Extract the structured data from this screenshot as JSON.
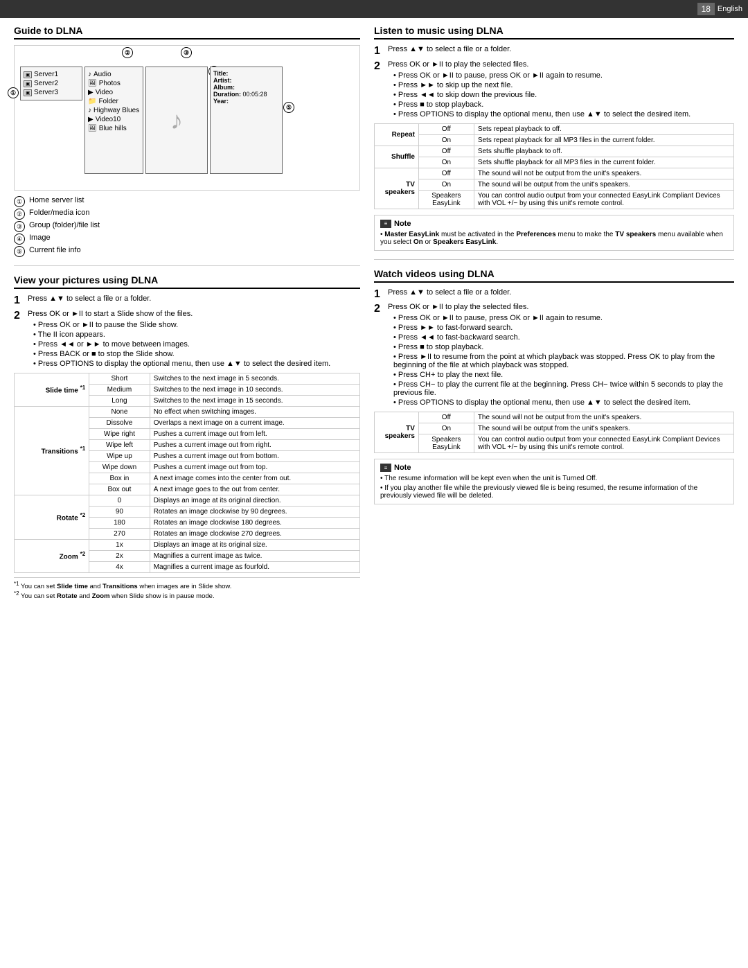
{
  "topbar": {
    "page": "18",
    "language": "English"
  },
  "left": {
    "guide_section": {
      "title": "Guide to DLNA",
      "diagram": {
        "callouts": [
          "①",
          "②",
          "③",
          "④",
          "⑤"
        ],
        "servers": [
          "Server1",
          "Server2",
          "Server3"
        ],
        "folders": [
          "Audio",
          "Photos",
          "Video",
          "Folder",
          "Highway Blues",
          "Video10",
          "Blue hills"
        ],
        "fileinfo": {
          "title_label": "Title:",
          "artist_label": "Artist:",
          "album_label": "Album:",
          "duration_label": "Duration:",
          "duration_value": "00:05:28",
          "year_label": "Year:"
        }
      },
      "legend": [
        {
          "num": "①",
          "text": "Home server list"
        },
        {
          "num": "②",
          "text": "Folder/media icon"
        },
        {
          "num": "③",
          "text": "Group (folder)/file list"
        },
        {
          "num": "④",
          "text": "Image"
        },
        {
          "num": "⑤",
          "text": "Current file info"
        }
      ]
    },
    "view_section": {
      "title": "View your pictures using DLNA",
      "step1": "Press ▲▼ to select a file or a folder.",
      "step2": "Press OK or ►II to start a Slide show of the files.",
      "bullets": [
        "Press OK or ►II to pause the Slide show.",
        "The II icon appears.",
        "Press ◄◄ or ►► to move between images.",
        "Press BACK or ■ to stop the Slide show.",
        "Press OPTIONS to display the optional menu, then use ▲▼ to select the desired item."
      ],
      "table": {
        "rows": [
          {
            "group": "Slide time *1",
            "entries": [
              {
                "sub": "Short",
                "desc": "Switches to the next image in 5 seconds."
              },
              {
                "sub": "Medium",
                "desc": "Switches to the next image in 10 seconds."
              },
              {
                "sub": "Long",
                "desc": "Switches to the next image in 15 seconds."
              }
            ]
          },
          {
            "group": "Transitions *1",
            "entries": [
              {
                "sub": "None",
                "desc": "No effect when switching images."
              },
              {
                "sub": "Dissolve",
                "desc": "Overlaps a next image on a current image."
              },
              {
                "sub": "Wipe right",
                "desc": "Pushes a current image out from left."
              },
              {
                "sub": "Wipe left",
                "desc": "Pushes a current image out from right."
              },
              {
                "sub": "Wipe up",
                "desc": "Pushes a current image out from bottom."
              },
              {
                "sub": "Wipe down",
                "desc": "Pushes a current image out from top."
              },
              {
                "sub": "Box in",
                "desc": "A next image comes into the center from out."
              },
              {
                "sub": "Box out",
                "desc": "A next image goes to the out from center."
              }
            ]
          },
          {
            "group": "Rotate *2",
            "entries": [
              {
                "sub": "0",
                "desc": "Displays an image at its original direction."
              },
              {
                "sub": "90",
                "desc": "Rotates an image clockwise by 90 degrees."
              },
              {
                "sub": "180",
                "desc": "Rotates an image clockwise 180 degrees."
              },
              {
                "sub": "270",
                "desc": "Rotates an image clockwise 270 degrees."
              }
            ]
          },
          {
            "group": "Zoom *2",
            "entries": [
              {
                "sub": "1x",
                "desc": "Displays an image at its original size."
              },
              {
                "sub": "2x",
                "desc": "Magnifies a current image as twice."
              },
              {
                "sub": "4x",
                "desc": "Magnifies a current image as fourfold."
              }
            ]
          }
        ]
      },
      "footnotes": [
        "*1 You can set Slide time and Transitions when images are in Slide show.",
        "*2 You can set Rotate and Zoom when Slide show is in pause mode."
      ]
    }
  },
  "right": {
    "listen_section": {
      "title": "Listen to music using DLNA",
      "step1": "Press ▲▼ to select a file or a folder.",
      "step2": "Press OK or ►II to play the selected files.",
      "bullets": [
        "Press OK or ►II to pause, press OK or ►II again to resume.",
        "Press ►► to skip up the next file.",
        "Press ◄◄ to skip down the previous file.",
        "Press ■ to stop playback.",
        "Press OPTIONS to display the optional menu, then use ▲▼ to select the desired item."
      ],
      "table": {
        "rows": [
          {
            "group": "Repeat",
            "entries": [
              {
                "sub": "Off",
                "desc": "Sets repeat playback to off."
              },
              {
                "sub": "On",
                "desc": "Sets repeat playback for all MP3 files in the current folder."
              }
            ]
          },
          {
            "group": "Shuffle",
            "entries": [
              {
                "sub": "Off",
                "desc": "Sets shuffle playback to off."
              },
              {
                "sub": "On",
                "desc": "Sets shuffle playback for all MP3 files in the current folder."
              }
            ]
          },
          {
            "group": "TV speakers",
            "entries": [
              {
                "sub": "Off",
                "desc": "The sound will not be output from the unit's speakers."
              },
              {
                "sub": "On",
                "desc": "The sound will be output from the unit's speakers."
              },
              {
                "sub": "Speakers EasyLink",
                "desc": "You can control audio output from your connected EasyLink Compliant Devices with VOL +/− by using this unit's remote control."
              }
            ]
          }
        ]
      },
      "note": {
        "label": "Note",
        "text": "Master EasyLink must be activated in the Preferences menu to make the TV speakers menu available when you select On or Speakers EasyLink."
      }
    },
    "watch_section": {
      "title": "Watch videos using DLNA",
      "step1": "Press ▲▼ to select a file or a folder.",
      "step2": "Press OK or ►II to play the selected files.",
      "bullets": [
        "Press OK or ►II to pause, press OK or ►II again to resume.",
        "Press ►► to fast-forward search.",
        "Press ◄◄ to fast-backward search.",
        "Press ■ to stop playback.",
        "Press ►II to resume from the point at which playback was stopped. Press OK to play from the beginning of the file at which playback was stopped.",
        "Press CH+ to play the next file.",
        "Press CH− to play the current file at the beginning. Press CH− twice within 5 seconds to play the previous file.",
        "Press OPTIONS to display the optional menu, then use ▲▼ to select the desired item."
      ],
      "table": {
        "rows": [
          {
            "group": "TV speakers",
            "entries": [
              {
                "sub": "Off",
                "desc": "The sound will not be output from the unit's speakers."
              },
              {
                "sub": "On",
                "desc": "The sound will be output from the unit's speakers."
              },
              {
                "sub": "Speakers EasyLink",
                "desc": "You can control audio output from your connected EasyLink Compliant Devices with VOL +/− by using this unit's remote control."
              }
            ]
          }
        ]
      },
      "notes": [
        "The resume information will be kept even when the unit is Turned Off.",
        "If you play another file while the previously viewed file is being resumed, the resume information of the previously viewed file will be deleted."
      ]
    }
  }
}
